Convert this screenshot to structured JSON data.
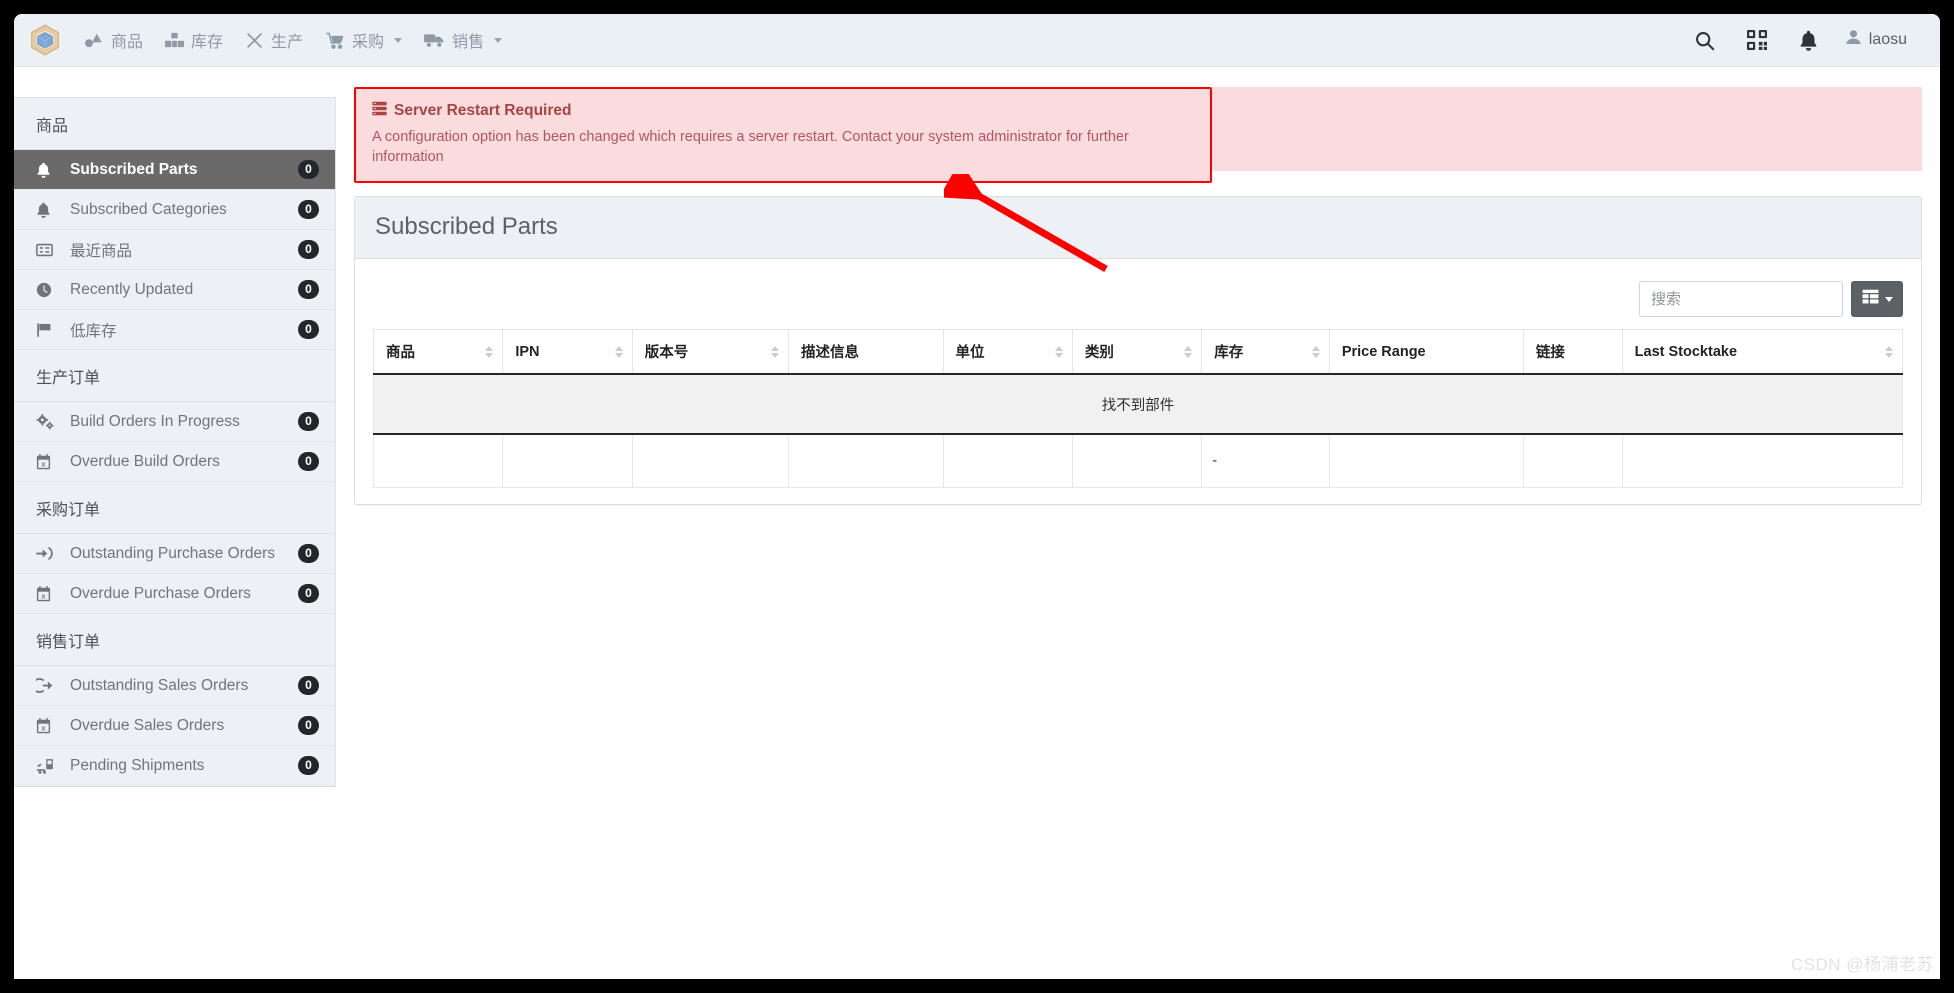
{
  "navbar": {
    "brand_icon": "inventree-cube-logo",
    "menu": [
      {
        "label": "商品",
        "icon": "shapes-icon",
        "has_caret": false
      },
      {
        "label": "库存",
        "icon": "boxes-icon",
        "has_caret": false
      },
      {
        "label": "生产",
        "icon": "tools-icon",
        "has_caret": false
      },
      {
        "label": "采购",
        "icon": "shopping-cart-icon",
        "has_caret": true
      },
      {
        "label": "销售",
        "icon": "truck-icon",
        "has_caret": true
      }
    ],
    "actions": [
      {
        "name": "search-icon"
      },
      {
        "name": "barcode-scan-icon"
      },
      {
        "name": "notification-bell-icon"
      }
    ],
    "user": {
      "name": "laosu",
      "icon": "user-icon",
      "has_caret": true
    }
  },
  "sidebar": {
    "groups": [
      {
        "heading": "商品",
        "items": [
          {
            "label": "Subscribed Parts",
            "icon": "bell-icon",
            "badge": "0",
            "active": true
          },
          {
            "label": "Subscribed Categories",
            "icon": "bell-icon",
            "badge": "0",
            "active": false
          },
          {
            "label": "最近商品",
            "icon": "list-alt-icon",
            "badge": "0",
            "active": false
          },
          {
            "label": "Recently Updated",
            "icon": "clock-icon",
            "badge": "0",
            "active": false
          },
          {
            "label": "低库存",
            "icon": "flag-icon",
            "badge": "0",
            "active": false
          }
        ]
      },
      {
        "heading": "生产订单",
        "items": [
          {
            "label": "Build Orders In Progress",
            "icon": "cogs-icon",
            "badge": "0",
            "active": false
          },
          {
            "label": "Overdue Build Orders",
            "icon": "calendar-times-icon",
            "badge": "0",
            "active": false
          }
        ]
      },
      {
        "heading": "采购订单",
        "items": [
          {
            "label": "Outstanding Purchase Orders",
            "icon": "sign-in-icon",
            "badge": "0",
            "active": false
          },
          {
            "label": "Overdue Purchase Orders",
            "icon": "calendar-times-icon",
            "badge": "0",
            "active": false
          }
        ]
      },
      {
        "heading": "销售订单",
        "items": [
          {
            "label": "Outstanding Sales Orders",
            "icon": "sign-out-icon",
            "badge": "0",
            "active": false
          },
          {
            "label": "Overdue Sales Orders",
            "icon": "calendar-times-icon",
            "badge": "0",
            "active": false
          },
          {
            "label": "Pending Shipments",
            "icon": "truck-loading-icon",
            "badge": "0",
            "active": false
          }
        ]
      }
    ]
  },
  "alert": {
    "icon": "server-icon",
    "title": "Server Restart Required",
    "message": "A configuration option has been changed which requires a server restart. Contact your system administrator for further information",
    "border_color": "#ff0000",
    "background_color": "#fadcdf",
    "title_color": "#a94442"
  },
  "panel": {
    "title": "Subscribed Parts"
  },
  "toolbar": {
    "search_placeholder": "搜索",
    "search_value": "",
    "columns_button_icon": "table-columns-icon",
    "columns_button_label": ""
  },
  "table": {
    "columns": [
      {
        "label": "商品",
        "sortable": true
      },
      {
        "label": "IPN",
        "sortable": true
      },
      {
        "label": "版本号",
        "sortable": true
      },
      {
        "label": "描述信息",
        "sortable": false
      },
      {
        "label": "单位",
        "sortable": true
      },
      {
        "label": "类别",
        "sortable": true
      },
      {
        "label": "库存",
        "sortable": true
      },
      {
        "label": "Price Range",
        "sortable": false
      },
      {
        "label": "链接",
        "sortable": false
      },
      {
        "label": "Last Stocktake",
        "sortable": true
      }
    ],
    "no_results_text": "找不到部件",
    "filler_row": [
      "",
      "",
      "",
      "",
      "",
      "",
      "-",
      "",
      "",
      ""
    ]
  },
  "annotation": {
    "arrow_color": "#ff0000"
  },
  "watermark": {
    "text": "CSDN @杨浦老苏"
  }
}
